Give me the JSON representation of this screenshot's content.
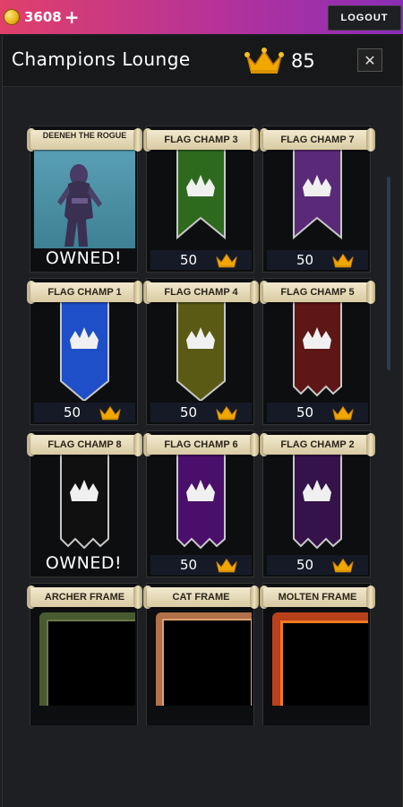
{
  "topbar": {
    "coins": "3608",
    "plus_label": "+",
    "logout_label": "LOGOUT"
  },
  "header": {
    "title": "Champions Lounge",
    "crowns": "85",
    "close_label": "✕"
  },
  "items": [
    {
      "name": "DEENEH THE ROGUE",
      "type": "character",
      "status": "OWNED!"
    },
    {
      "name": "FLAG CHAMP 3",
      "type": "flag",
      "color": "#2e6a1e",
      "price": "50"
    },
    {
      "name": "FLAG CHAMP 7",
      "type": "flag",
      "color": "#5a2a78",
      "price": "50"
    },
    {
      "name": "FLAG CHAMP 1",
      "type": "flag",
      "color": "#1f4fc8",
      "price": "50"
    },
    {
      "name": "FLAG CHAMP 4",
      "type": "flag",
      "color": "#5a5a14",
      "price": "50"
    },
    {
      "name": "FLAG CHAMP 5",
      "type": "flag",
      "color": "#5e1616",
      "price": "50"
    },
    {
      "name": "FLAG CHAMP 8",
      "type": "flag",
      "color": "#101010",
      "status": "OWNED!"
    },
    {
      "name": "FLAG CHAMP 6",
      "type": "flag",
      "color": "#4a0f6a",
      "price": "50"
    },
    {
      "name": "FLAG CHAMP 2",
      "type": "flag",
      "color": "#35124a",
      "price": "50"
    },
    {
      "name": "ARCHER FRAME",
      "type": "frame",
      "color": "#5a6a3a"
    },
    {
      "name": "CAT FRAME",
      "type": "frame",
      "color": "#c08050"
    },
    {
      "name": "MOLTEN FRAME",
      "type": "frame",
      "color": "#c0461a"
    }
  ],
  "colors": {
    "accent_gold": "#f0a800",
    "price_bar": "#151a26",
    "topbar_start": "#e0406a",
    "topbar_end": "#8a2db6"
  }
}
